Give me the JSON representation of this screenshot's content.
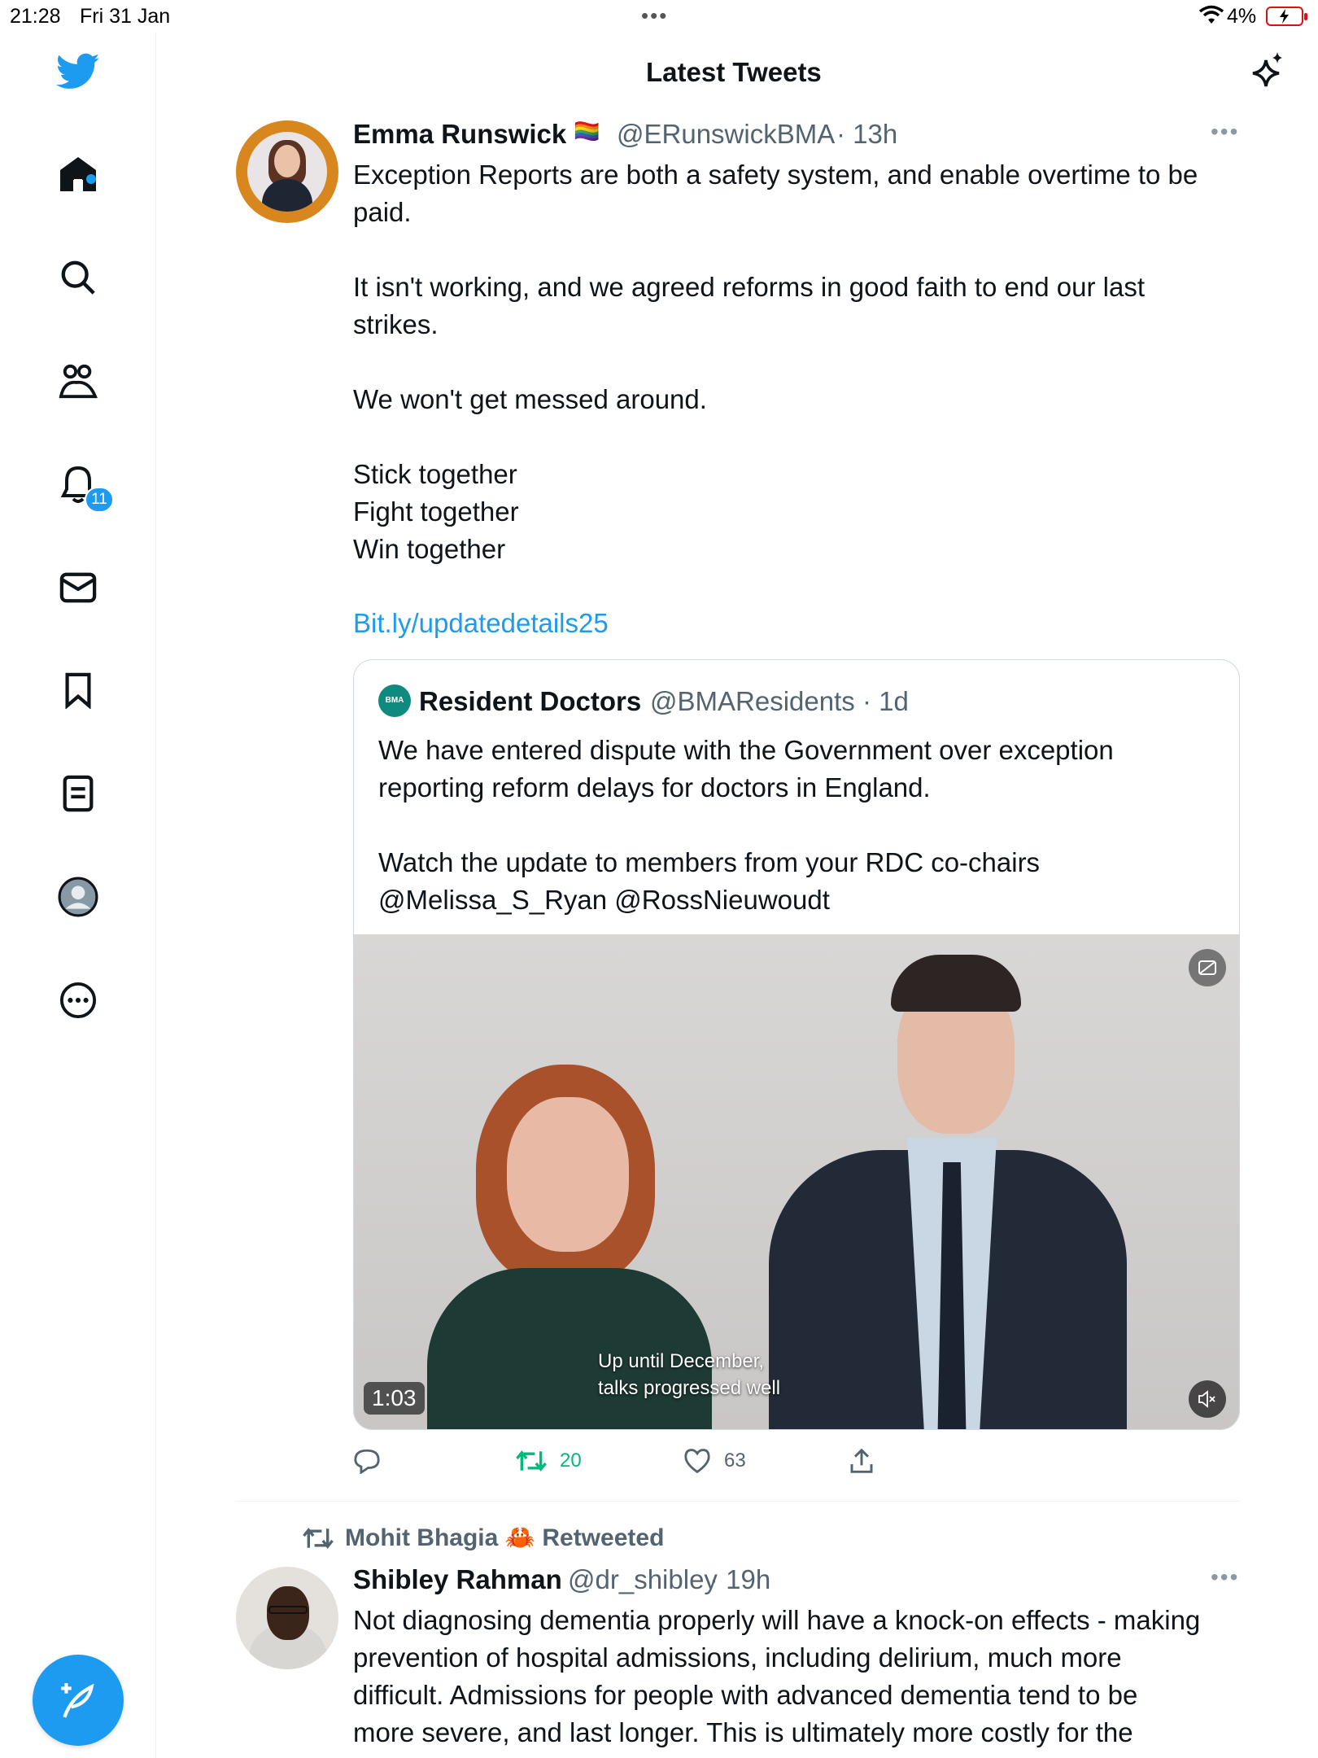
{
  "status_bar": {
    "time": "21:28",
    "date": "Fri 31 Jan",
    "battery_percent": "4%"
  },
  "header": {
    "title": "Latest Tweets"
  },
  "sidebar": {
    "notifications_badge": "11",
    "items": [
      "home",
      "explore",
      "communities",
      "notifications",
      "messages",
      "bookmarks",
      "lists",
      "profile",
      "more"
    ]
  },
  "tweet1": {
    "author_name": "Emma Runswick",
    "author_emoji": "🏳️‍🌈",
    "author_handle": "@ERunswickBMA",
    "time": "· 13h",
    "text": "Exception Reports are both a safety system, and enable overtime to be\npaid.\n\nIt isn't working, and we agreed reforms in good faith to end our last\nstrikes.\n\nWe won't get messed around.\n\nStick together\nFight together\nWin together",
    "link": "Bit.ly/updatedetails25",
    "quote": {
      "avatar_label": "BMA",
      "author_name": "Resident Doctors",
      "author_handle": "@BMAResidents",
      "time": "· 1d",
      "text": "We have entered dispute with the Government over exception\nreporting reform delays for doctors in England.\n\nWatch the update to members from your RDC co-chairs\n@Melissa_S_Ryan @RossNieuwoudt",
      "video": {
        "caption_line1": "Up until December,",
        "caption_line2": "talks progressed well",
        "duration": "1:03"
      }
    },
    "actions": {
      "retweets": "20",
      "likes": "63"
    }
  },
  "tweet2": {
    "retweeted_by": "Mohit Bhagia 🦀 Retweeted",
    "author_name": "Shibley Rahman",
    "author_handle": "@dr_shibley",
    "time": "· 19h",
    "text": "Not diagnosing dementia properly will have a knock-on effects - making\nprevention of hospital admissions, including delirium, much more\ndifficult. Admissions for people with advanced dementia tend to be\nmore severe, and last longer. This is ultimately more costly for the"
  },
  "colors": {
    "accent": "#1d9bf0",
    "retweet_green": "#00ba7c",
    "muted": "#536471"
  }
}
